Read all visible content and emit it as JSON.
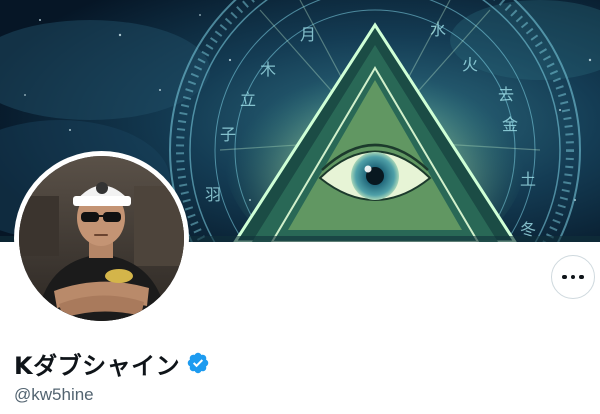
{
  "profile": {
    "display_name": "Kダブシャイン",
    "handle": "@kw5hine",
    "verified": true
  },
  "icons": {
    "banner": "all-seeing-eye-illustration",
    "avatar": "profile-photo",
    "verified": "verified-badge-icon",
    "more": "more-options-icon"
  },
  "colors": {
    "verified": "#1d9bf0",
    "text_primary": "#0f1419",
    "text_secondary": "#536471",
    "border": "#cfd9de"
  }
}
